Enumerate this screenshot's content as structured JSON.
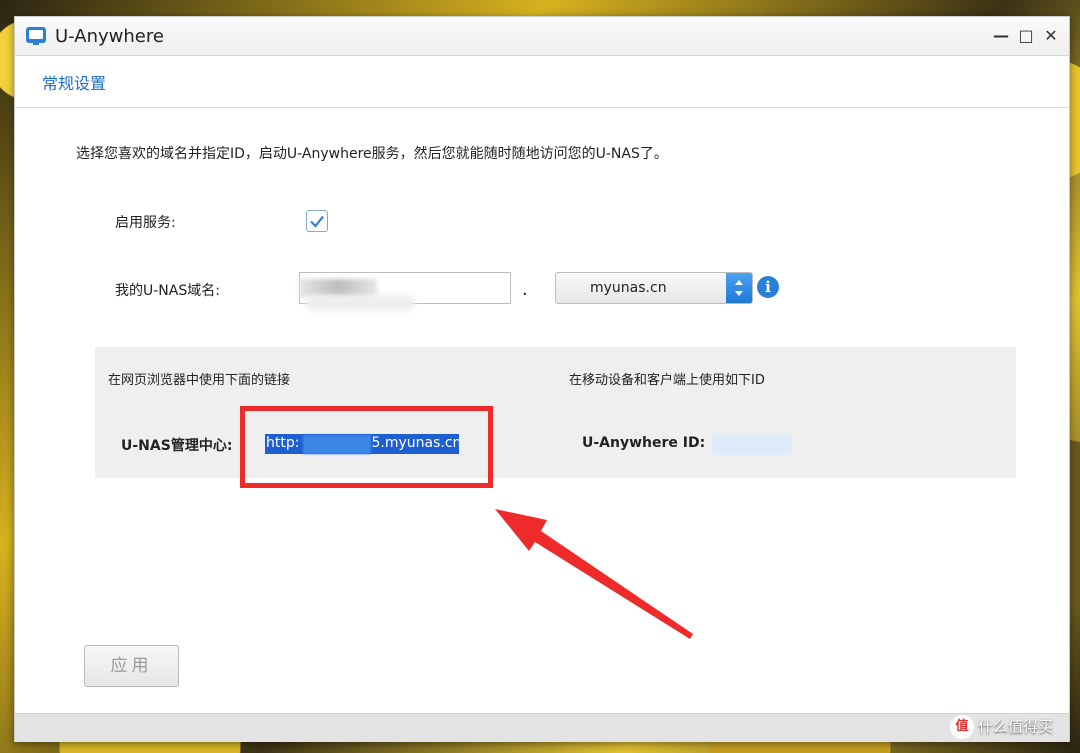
{
  "window": {
    "title": "U-Anywhere",
    "controls": {
      "minimize": "—",
      "maximize": "□",
      "close": "✕"
    }
  },
  "tabs": {
    "general": "常规设置"
  },
  "intro": "选择您喜欢的域名并指定ID，启动U-Anywhere服务，然后您就能随时随地访问您的U-NAS了。",
  "form": {
    "enable_label": "启用服务:",
    "enable_checked": true,
    "domain_label": "我的U-NAS域名:",
    "domain_separator": ".",
    "domain_select_value": "myunas.cn"
  },
  "panel": {
    "browser_heading": "在网页浏览器中使用下面的链接",
    "mobile_heading": "在移动设备和客户端上使用如下ID",
    "center_label": "U-NAS管理中心:",
    "center_link_prefix": "http:",
    "center_link_suffix": "5.myunas.cn",
    "id_label": "U-Anywhere ID:"
  },
  "apply_button": "应用",
  "watermark": {
    "text": "什么值得买",
    "icon": "值"
  },
  "colors": {
    "accent": "#1f6fc9",
    "annotation": "#ee2a2a",
    "link_highlight": "#1d5fd0"
  }
}
